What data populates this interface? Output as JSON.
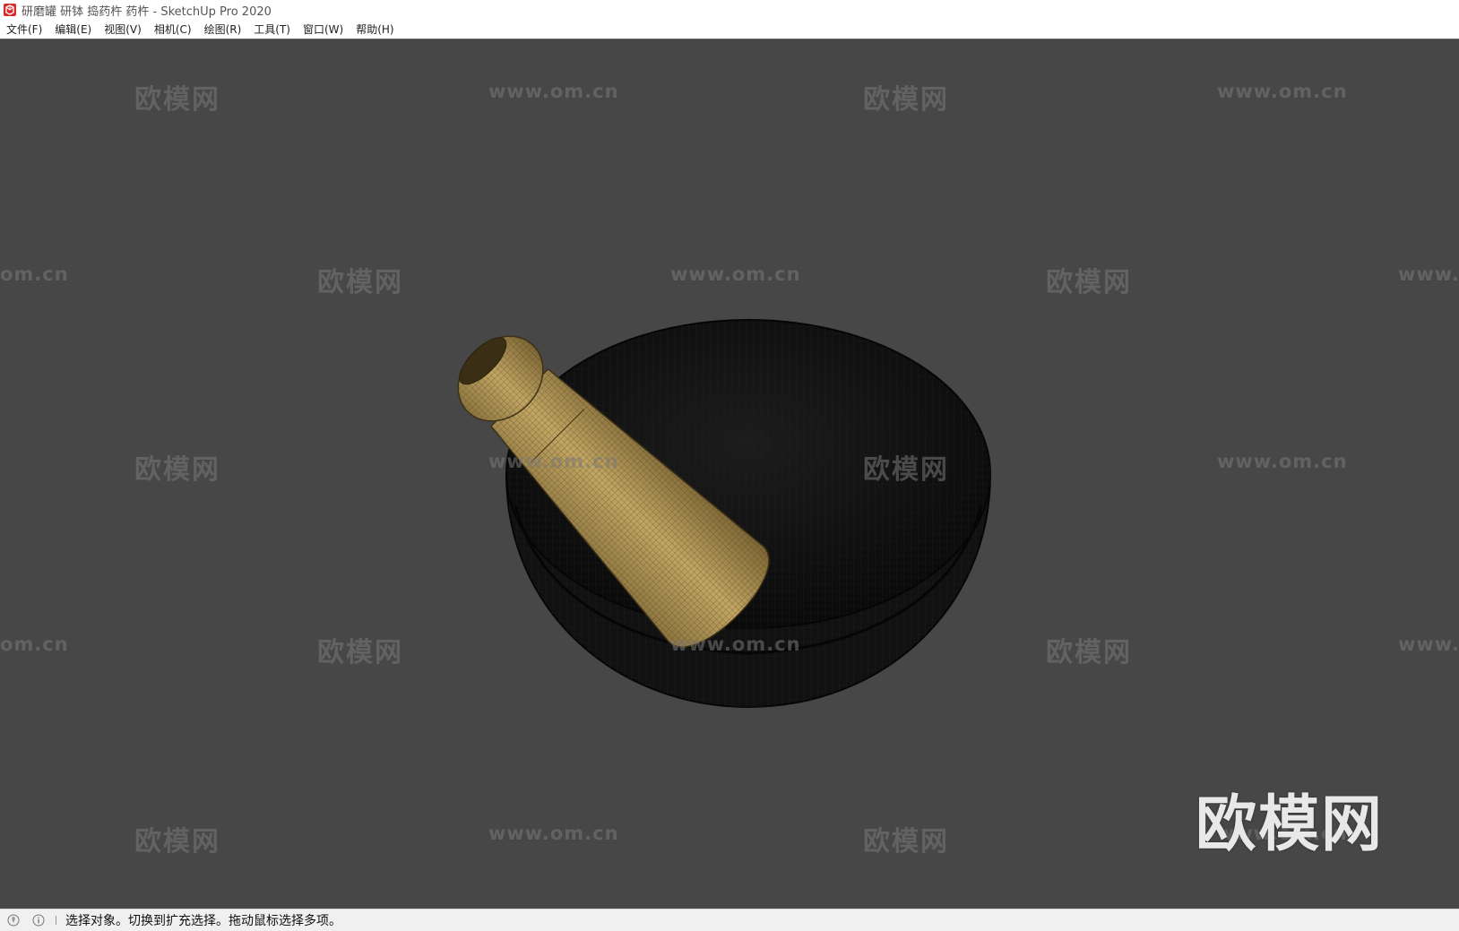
{
  "window": {
    "title": "研磨罐 研钵 捣药杵 药杵 - SketchUp Pro 2020",
    "app_icon": "sketchup-logo-icon"
  },
  "menu": {
    "items": [
      {
        "label": "文件(F)"
      },
      {
        "label": "编辑(E)"
      },
      {
        "label": "视图(V)"
      },
      {
        "label": "相机(C)"
      },
      {
        "label": "绘图(R)"
      },
      {
        "label": "工具(T)"
      },
      {
        "label": "窗口(W)"
      },
      {
        "label": "帮助(H)"
      }
    ]
  },
  "viewport": {
    "background_color": "#474747",
    "model": {
      "bowl_color": "#141414",
      "pestle_color": "#b59a5a",
      "wireframe": true
    },
    "watermarks": {
      "cn": "欧模网",
      "url": "www.om.cn",
      "url_cropped_left": "om.cn",
      "url_cropped_right": "www."
    },
    "brand_mark": "欧模网"
  },
  "status": {
    "icons": [
      "geo-location-icon",
      "credits-info-icon"
    ],
    "text": "选择对象。切换到扩充选择。拖动鼠标选择多项。"
  },
  "colors": {
    "titlebar_bg": "#ffffff",
    "statusbar_bg": "#f0f0f0",
    "sketchup_red": "#d62b2b"
  }
}
